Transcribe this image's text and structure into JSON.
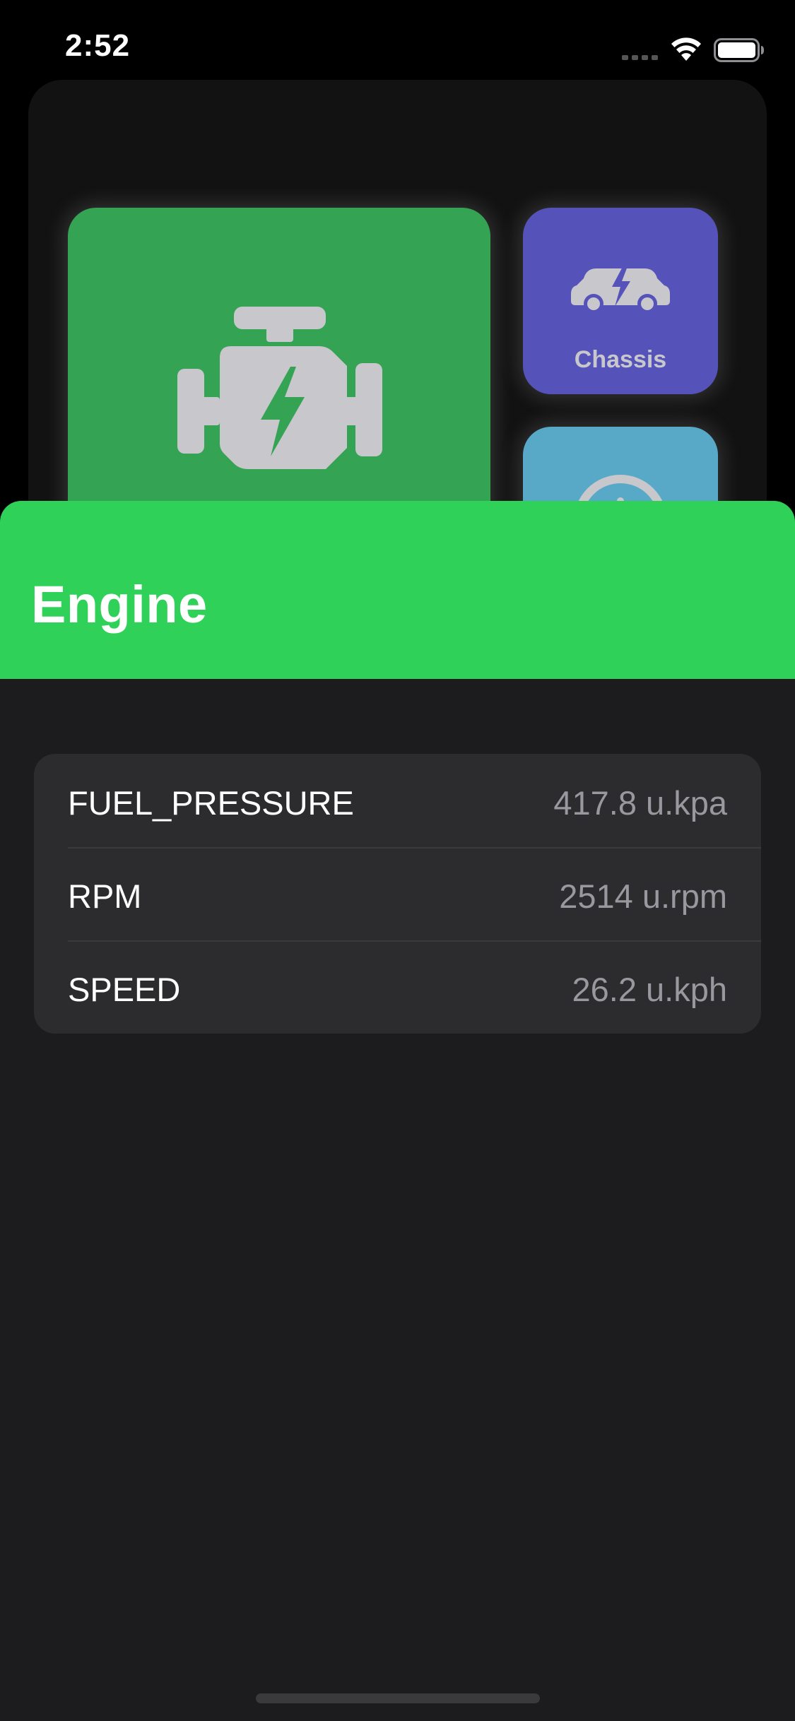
{
  "status_bar": {
    "time": "2:52"
  },
  "dashboard": {
    "tiles": {
      "chassis_label": "Chassis"
    }
  },
  "sheet": {
    "title": "Engine",
    "readings": [
      {
        "name": "FUEL_PRESSURE",
        "value": "417.8 u.kpa"
      },
      {
        "name": "RPM",
        "value": "2514 u.rpm"
      },
      {
        "name": "SPEED",
        "value": "26.2 u.kph"
      }
    ]
  },
  "icons": {
    "engine_tile": "engine-icon",
    "chassis_tile": "car-bolt-icon",
    "third_tile": "gauge-icon",
    "status": [
      "cellular-signal-icon",
      "wifi-icon",
      "battery-icon"
    ]
  },
  "colors": {
    "accent_green": "#30d158",
    "engine_tile": "#34a354",
    "chassis_tile": "#5553b9",
    "third_tile": "#58a9c7",
    "background": "#1c1c1e",
    "row_background": "#2c2c2e",
    "value_text": "#98989e"
  }
}
